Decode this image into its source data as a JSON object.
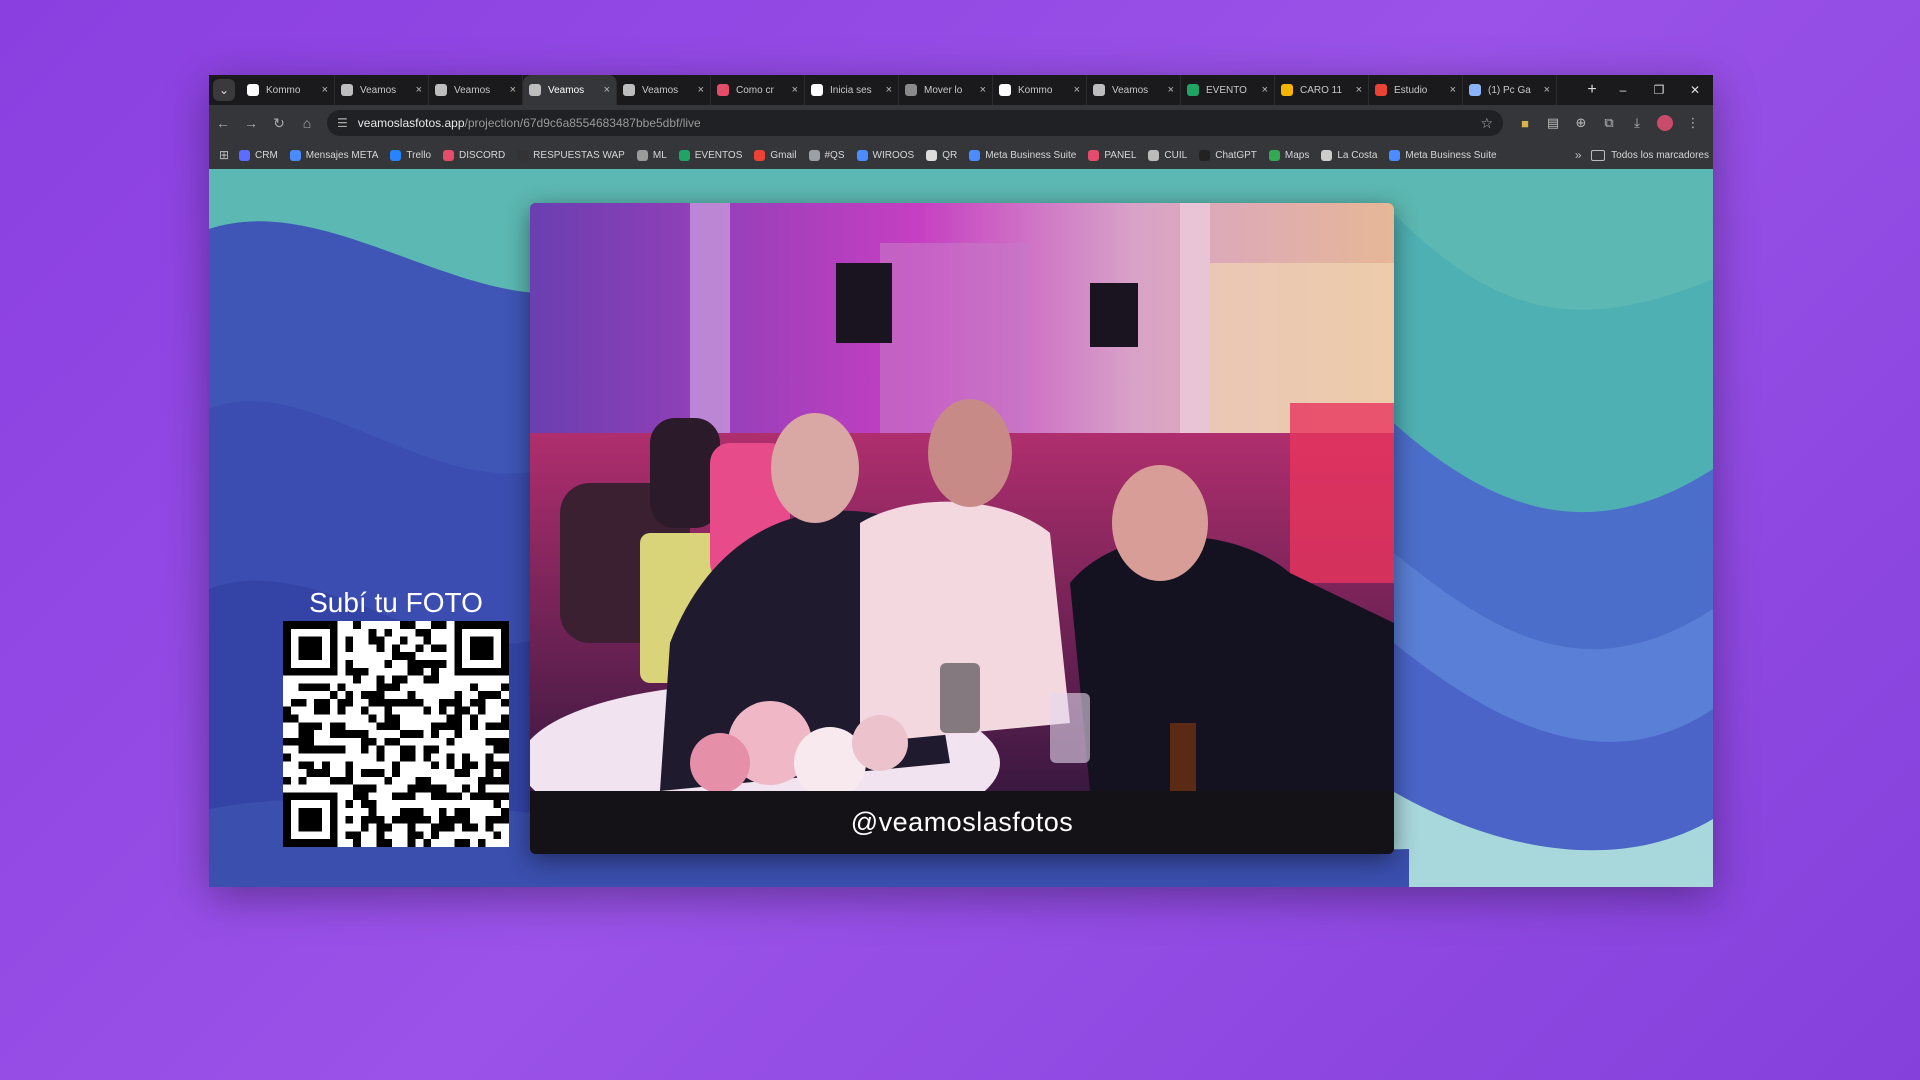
{
  "browser": {
    "tabs": [
      {
        "title": "Kommo",
        "color": "#ffffff",
        "active": false
      },
      {
        "title": "Veamos",
        "color": "#bdbdbd",
        "active": false
      },
      {
        "title": "Veamos",
        "color": "#bdbdbd",
        "active": false
      },
      {
        "title": "Veamos",
        "color": "#bdbdbd",
        "active": true
      },
      {
        "title": "Veamos",
        "color": "#bdbdbd",
        "active": false
      },
      {
        "title": "Como cr",
        "color": "#e44c6a",
        "active": false
      },
      {
        "title": "Inicia ses",
        "color": "#ffffff",
        "active": false
      },
      {
        "title": "Mover lo",
        "color": "#8a8a8a",
        "active": false
      },
      {
        "title": "Kommo",
        "color": "#ffffff",
        "active": false
      },
      {
        "title": "Veamos",
        "color": "#bdbdbd",
        "active": false
      },
      {
        "title": "EVENTO",
        "color": "#1fa463",
        "active": false
      },
      {
        "title": "CARO 11",
        "color": "#f4b400",
        "active": false
      },
      {
        "title": "Estudio",
        "color": "#ea4335",
        "active": false
      },
      {
        "title": "(1) Pc Ga",
        "color": "#8ab4f8",
        "active": false
      }
    ],
    "tab_close_glyph": "×",
    "new_tab_glyph": "+",
    "url_host": "veamoslasfotos.app",
    "url_path": "/projection/67d9c6a8554683487bbe5dbf/live",
    "bookmarks": [
      {
        "label": "CRM",
        "color": "#5b6cff"
      },
      {
        "label": "Mensajes META",
        "color": "#4a8cff"
      },
      {
        "label": "Trello",
        "color": "#2684ff"
      },
      {
        "label": "DISCORD",
        "color": "#e44c6a"
      },
      {
        "label": "RESPUESTAS WAP",
        "color": "#333333"
      },
      {
        "label": "ML",
        "color": "#9a9a9a"
      },
      {
        "label": "EVENTOS",
        "color": "#1fa463"
      },
      {
        "label": "Gmail",
        "color": "#ea4335"
      },
      {
        "label": "#QS",
        "color": "#9aa0a6"
      },
      {
        "label": "WIROOS",
        "color": "#4a8cff"
      },
      {
        "label": "QR",
        "color": "#dddddd"
      },
      {
        "label": "Meta Business Suite",
        "color": "#4a8cff"
      },
      {
        "label": "PANEL",
        "color": "#e44c6a"
      },
      {
        "label": "CUIL",
        "color": "#bbbbbb"
      },
      {
        "label": "ChatGPT",
        "color": "#222222"
      },
      {
        "label": "Maps",
        "color": "#34a853"
      },
      {
        "label": "La Costa",
        "color": "#cccccc"
      },
      {
        "label": "Meta Business Suite",
        "color": "#4a8cff"
      }
    ],
    "all_bookmarks_label": "Todos los marcadores"
  },
  "page": {
    "upload_title": "Subí tu FOTO",
    "caption": "@veamoslasfotos",
    "accent_colors": {
      "wave_dark": "#3d4fb8",
      "wave_mid": "#4a63c9",
      "wave_light": "#5fb3b3"
    }
  }
}
